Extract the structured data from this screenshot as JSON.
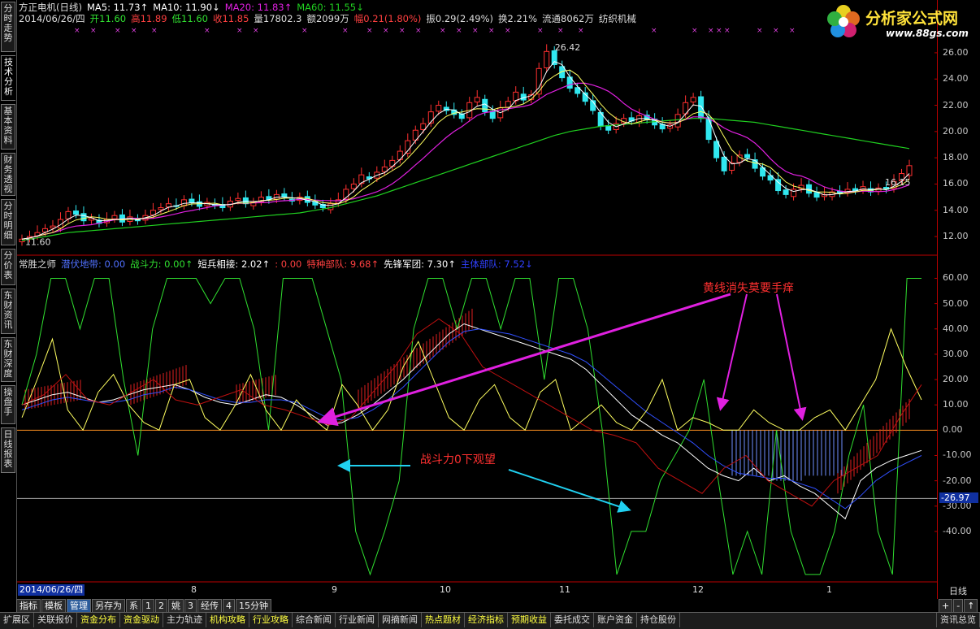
{
  "sidebar": [
    {
      "label": "分时走势"
    },
    {
      "label": "技术分析",
      "active": true
    },
    {
      "label": "基本资料"
    },
    {
      "label": "财务透视"
    },
    {
      "label": "分时明细"
    },
    {
      "label": "分价表"
    },
    {
      "label": "东财资讯"
    },
    {
      "label": "东财深度"
    },
    {
      "label": "操盘手"
    },
    {
      "label": "日线报表"
    }
  ],
  "header": {
    "line1": [
      {
        "t": "方正电机(日线)",
        "c": "#dddddd"
      },
      {
        "t": "MA5: 11.73↑",
        "c": "#ffffff"
      },
      {
        "t": "MA10: 11.90↓",
        "c": "#ffffff"
      },
      {
        "t": "MA20: 11.83↑",
        "c": "#e020e0"
      },
      {
        "t": "MA60: 11.55↓",
        "c": "#20d020"
      }
    ],
    "line2": [
      {
        "t": "2014/06/26/四",
        "c": "#dddddd"
      },
      {
        "t": "开11.60",
        "c": "#30e030"
      },
      {
        "t": "高11.89",
        "c": "#ff4040"
      },
      {
        "t": "低11.60",
        "c": "#30e030"
      },
      {
        "t": "收11.85",
        "c": "#ff4040"
      },
      {
        "t": "量17802.3",
        "c": "#dddddd"
      },
      {
        "t": "额2099万",
        "c": "#dddddd"
      },
      {
        "t": "幅0.21(1.80%)",
        "c": "#ff4040"
      },
      {
        "t": "振0.29(2.49%)",
        "c": "#dddddd"
      },
      {
        "t": "换2.21%",
        "c": "#dddddd"
      },
      {
        "t": "流通8062万",
        "c": "#dddddd"
      },
      {
        "t": "纺织机械",
        "c": "#dddddd"
      }
    ],
    "ind": [
      {
        "t": "常胜之师",
        "c": "#dddddd"
      },
      {
        "t": "潜伏地带: 0.00",
        "c": "#5070ff"
      },
      {
        "t": "战斗力: 0.00↑",
        "c": "#30e030"
      },
      {
        "t": "短兵相接: 2.02↑",
        "c": "#ffffff"
      },
      {
        "t": ": 0.00",
        "c": "#ff4040"
      },
      {
        "t": "特种部队: 9.68↑",
        "c": "#ff4040"
      },
      {
        "t": "先锋军团: 7.30↑",
        "c": "#ffffff"
      },
      {
        "t": "主体部队: 7.52↓",
        "c": "#3040ff"
      }
    ]
  },
  "logo": {
    "title": "分析家公式网",
    "url": "www.88gs.com"
  },
  "xmarks": "××",
  "chart_data": [
    {
      "type": "candlestick",
      "ylim": [
        11.2,
        26.8
      ],
      "yticks": [
        12.0,
        14.0,
        16.0,
        18.0,
        20.0,
        22.0,
        24.0,
        26.0
      ],
      "annotations": {
        "high_label": "26.42",
        "low_label": "11.60",
        "last_label": "16.15"
      },
      "ma_colors": {
        "MA5": "#ffffff",
        "MA10": "#ffff60",
        "MA20": "#e020e0",
        "MA60": "#20d020"
      },
      "close": [
        11.8,
        12.0,
        12.3,
        12.6,
        12.8,
        13.3,
        13.9,
        13.7,
        13.2,
        13.4,
        13.0,
        13.3,
        13.6,
        13.1,
        13.5,
        13.2,
        13.6,
        14.0,
        14.2,
        14.5,
        14.3,
        14.8,
        14.6,
        14.3,
        14.6,
        14.4,
        14.2,
        14.7,
        14.9,
        14.5,
        14.6,
        15.0,
        14.8,
        15.2,
        15.0,
        14.7,
        15.0,
        14.6,
        14.4,
        14.2,
        14.5,
        14.8,
        15.6,
        16.0,
        16.7,
        16.4,
        16.9,
        17.3,
        17.8,
        18.5,
        19.3,
        20.1,
        20.6,
        21.5,
        22.0,
        21.6,
        21.3,
        21.0,
        22.2,
        22.6,
        21.5,
        21.0,
        21.8,
        22.3,
        23.0,
        22.4,
        22.8,
        24.8,
        26.1,
        25.1,
        24.1,
        23.3,
        22.9,
        22.3,
        21.6,
        20.4,
        20.1,
        20.6,
        21.0,
        20.8,
        21.2,
        20.9,
        20.5,
        20.2,
        20.5,
        21.3,
        22.2,
        22.6,
        21.0,
        19.4,
        18.0,
        17.0,
        17.6,
        18.2,
        18.0,
        17.2,
        16.6,
        16.3,
        15.5,
        15.2,
        15.6,
        15.9,
        15.3,
        15.0,
        15.2,
        15.4,
        15.3,
        15.6,
        15.5,
        15.8,
        15.4,
        15.7,
        15.6,
        16.2,
        16.8,
        17.4
      ],
      "ma60": [
        11.7,
        11.8,
        11.9,
        12.0,
        12.1,
        12.2,
        12.3,
        12.35,
        12.4,
        12.45,
        12.5,
        12.55,
        12.6,
        12.65,
        12.7,
        12.75,
        12.8,
        12.85,
        12.9,
        12.95,
        13.0,
        13.05,
        13.1,
        13.15,
        13.2,
        13.25,
        13.3,
        13.35,
        13.4,
        13.45,
        13.5,
        13.55,
        13.6,
        13.65,
        13.7,
        13.75,
        13.8,
        13.9,
        14.0,
        14.1,
        14.2,
        14.35,
        14.5,
        14.65,
        14.8,
        14.95,
        15.1,
        15.3,
        15.5,
        15.7,
        15.9,
        16.1,
        16.3,
        16.5,
        16.7,
        16.9,
        17.1,
        17.3,
        17.5,
        17.7,
        17.9,
        18.1,
        18.3,
        18.5,
        18.7,
        18.9,
        19.1,
        19.3,
        19.5,
        19.7,
        19.85,
        20.0,
        20.1,
        20.2,
        20.3,
        20.4,
        20.45,
        20.5,
        20.55,
        20.6,
        20.65,
        20.7,
        20.75,
        20.8,
        20.85,
        20.9,
        20.95,
        21.0,
        21.0,
        21.0,
        20.95,
        20.9,
        20.85,
        20.8,
        20.75,
        20.7,
        20.6,
        20.5,
        20.4,
        20.3,
        20.2,
        20.1,
        20.0,
        19.9,
        19.8,
        19.7,
        19.6,
        19.5,
        19.4,
        19.3,
        19.2,
        19.1,
        19.0,
        18.9,
        18.8,
        18.7
      ]
    },
    {
      "type": "line",
      "ylim": [
        -58,
        64
      ],
      "yticks": [
        60.0,
        50.0,
        40.0,
        30.0,
        20.0,
        10.0,
        0.0,
        -10.0,
        -20.0,
        -30.0,
        -40.0
      ],
      "cursor_label": "-26.97",
      "cursor_value": -26.97,
      "series": [
        {
          "name": "战斗力",
          "color": "#30e030",
          "values": [
            10,
            30,
            60,
            60,
            40,
            60,
            60,
            20,
            -10,
            40,
            60,
            60,
            60,
            50,
            60,
            60,
            40,
            0,
            60,
            60,
            60,
            40,
            20,
            -40,
            -57,
            -40,
            -20,
            40,
            60,
            60,
            40,
            60,
            60,
            40,
            60,
            60,
            20,
            60,
            60,
            40,
            0,
            -57,
            -40,
            -40,
            -20,
            -10,
            0,
            20,
            -20,
            -57,
            -40,
            -57,
            0,
            -40,
            -57,
            -57,
            -40,
            -10,
            10,
            -40,
            -57,
            60,
            60
          ]
        },
        {
          "name": "先锋军团",
          "color": "#ffffff",
          "values": [
            10,
            12,
            14,
            15,
            13,
            11,
            12,
            14,
            16,
            17,
            18,
            16,
            13,
            11,
            10,
            12,
            14,
            13,
            10,
            6,
            2,
            3,
            6,
            10,
            15,
            20,
            26,
            32,
            38,
            42,
            40,
            38,
            36,
            34,
            32,
            30,
            28,
            24,
            18,
            12,
            6,
            2,
            -2,
            -5,
            -10,
            -15,
            -18,
            -20,
            -15,
            -20,
            -18,
            -22,
            -25,
            -30,
            -35,
            -20,
            -15,
            -12,
            -10,
            -8
          ]
        },
        {
          "name": "主体部队",
          "color": "#3050ff",
          "values": [
            8,
            10,
            12,
            13,
            12,
            11,
            11,
            12,
            14,
            15,
            17,
            16,
            14,
            12,
            11,
            11,
            12,
            12,
            11,
            8,
            5,
            4,
            5,
            8,
            12,
            17,
            23,
            29,
            35,
            39,
            40,
            39,
            38,
            36,
            34,
            32,
            30,
            27,
            22,
            17,
            12,
            7,
            3,
            -1,
            -5,
            -10,
            -14,
            -17,
            -18,
            -19,
            -19,
            -21,
            -23,
            -27,
            -31,
            -26,
            -20,
            -16,
            -13,
            -10
          ]
        },
        {
          "name": "短兵相接",
          "color": "#ffff60",
          "values": [
            5,
            20,
            36,
            8,
            0,
            15,
            22,
            10,
            3,
            0,
            18,
            20,
            5,
            0,
            10,
            22,
            8,
            0,
            12,
            5,
            0,
            18,
            10,
            0,
            8,
            25,
            35,
            20,
            5,
            0,
            12,
            18,
            5,
            0,
            15,
            20,
            0,
            5,
            10,
            3,
            0,
            8,
            20,
            0,
            5,
            3,
            0,
            0,
            8,
            3,
            0,
            0,
            5,
            8,
            0,
            10,
            20,
            40,
            25,
            12
          ]
        }
      ],
      "texts": {
        "top_note": "黄线消失莫要手痒",
        "mid_note": "战斗力0下观望"
      }
    }
  ],
  "xaxis": {
    "date_box": "2014/06/26/四",
    "labels": [
      {
        "t": "8"
      },
      {
        "t": "9"
      },
      {
        "t": "10"
      },
      {
        "t": "11"
      },
      {
        "t": "12"
      },
      {
        "t": "1"
      }
    ],
    "period": "日线"
  },
  "toolbar": [
    "指标",
    "模板",
    "管理",
    "另存为",
    "系",
    "1",
    "2",
    "姚",
    "3",
    "经传",
    "4",
    "15分钟"
  ],
  "toolbar_active": "管理",
  "bottom": [
    {
      "t": "扩展区",
      "c": "#dddddd"
    },
    {
      "t": "关联报价",
      "c": "#dddddd"
    },
    {
      "t": "资金分布",
      "c": "#ffff40"
    },
    {
      "t": "资金驱动",
      "c": "#ffff40"
    },
    {
      "t": "主力轨迹",
      "c": "#dddddd"
    },
    {
      "t": "机构攻略",
      "c": "#ffff40"
    },
    {
      "t": "行业攻略",
      "c": "#ffff40"
    },
    {
      "t": "综合新闻",
      "c": "#dddddd"
    },
    {
      "t": "行业新闻",
      "c": "#dddddd"
    },
    {
      "t": "网摘新闻",
      "c": "#dddddd"
    },
    {
      "t": "热点题材",
      "c": "#ffff40"
    },
    {
      "t": "经济指标",
      "c": "#ffff40"
    },
    {
      "t": "预期收益",
      "c": "#ffff40"
    },
    {
      "t": "委托成交",
      "c": "#dddddd"
    },
    {
      "t": "账户资金",
      "c": "#dddddd"
    },
    {
      "t": "持仓股份",
      "c": "#dddddd"
    }
  ],
  "bottom_right": "资讯总览",
  "zoom": [
    "+",
    "-",
    "↑",
    "↓"
  ]
}
